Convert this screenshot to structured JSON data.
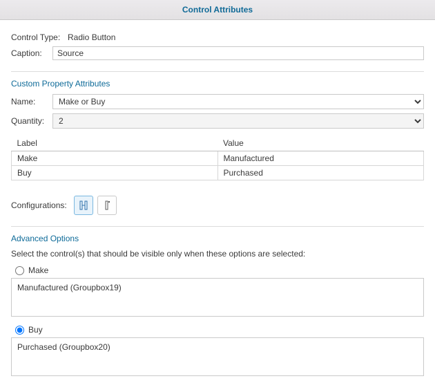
{
  "title": "Control Attributes",
  "general": {
    "controlTypeLabel": "Control Type:",
    "controlTypeValue": "Radio Button",
    "captionLabel": "Caption:",
    "captionValue": "Source"
  },
  "customProps": {
    "sectionTitle": "Custom Property Attributes",
    "nameLabel": "Name:",
    "nameValue": "Make or Buy",
    "quantityLabel": "Quantity:",
    "quantityValue": "2",
    "columns": {
      "label": "Label",
      "value": "Value"
    },
    "rows": [
      {
        "label": "Make",
        "value": "Manufactured"
      },
      {
        "label": "Buy",
        "value": "Purchased"
      }
    ],
    "configurationsLabel": "Configurations:"
  },
  "advanced": {
    "sectionTitle": "Advanced Options",
    "description": "Select the control(s) that should be visible only when these options are selected:",
    "options": [
      {
        "label": "Make",
        "list": "Manufactured (Groupbox19)"
      },
      {
        "label": "Buy",
        "list": "Purchased (Groupbox20)"
      }
    ]
  }
}
